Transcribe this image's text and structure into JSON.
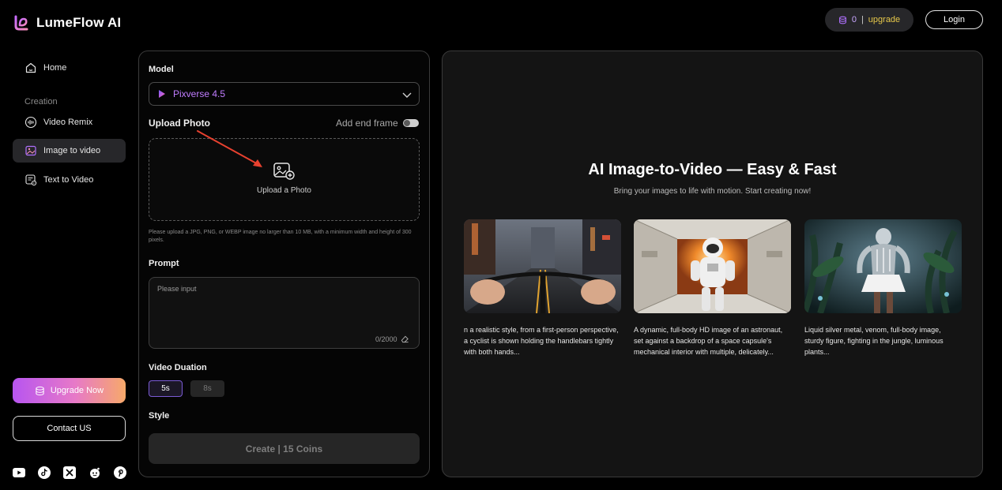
{
  "brand": {
    "name": "LumeFlow AI"
  },
  "header": {
    "coins": "0",
    "separator": "|",
    "upgrade_link": "upgrade",
    "login_label": "Login"
  },
  "sidebar": {
    "home": "Home",
    "section": "Creation",
    "items": [
      "Video Remix",
      "Image to video",
      "Text to Video"
    ],
    "active_index": 1,
    "upgrade_label": "Upgrade Now",
    "contact_label": "Contact US",
    "socials": [
      "youtube-icon",
      "tiktok-icon",
      "x-icon",
      "reddit-icon",
      "pinterest-icon"
    ]
  },
  "form": {
    "model_label": "Model",
    "model_value": "Pixverse 4.5",
    "upload_label": "Upload Photo",
    "end_frame_label": "Add end frame",
    "end_frame_on": false,
    "upload_cta": "Upload a Photo",
    "upload_hint": "Please upload a JPG, PNG, or WEBP image no larger than 10 MB, with a minimum width and height of 300 pixels.",
    "prompt_label": "Prompt",
    "prompt_placeholder": "Please input",
    "prompt_counter": "0/2000",
    "duration_label": "Video Duation",
    "durations": [
      "5s",
      "8s"
    ],
    "duration_selected": "5s",
    "style_label": "Style",
    "create_label": "Create | 15 Coins"
  },
  "hero": {
    "title": "AI Image-to-Video — Easy & Fast",
    "subtitle": "Bring your images to life with motion. Start creating now!",
    "cards": [
      {
        "caption": "n a realistic style, from a first-person perspective, a cyclist is shown holding the handlebars tightly with both hands..."
      },
      {
        "caption": "A dynamic, full-body HD image of an astronaut, set against a backdrop of a space capsule's mechanical interior with multiple, delicately..."
      },
      {
        "caption": "Liquid silver metal, venom, full-body image, sturdy figure, fighting in the jungle, luminous plants..."
      }
    ]
  },
  "colors": {
    "accent": "#b070ff",
    "coins": "#c8a6ff",
    "upgrade_link": "#e6c84a",
    "arrow": "#e8412f"
  }
}
